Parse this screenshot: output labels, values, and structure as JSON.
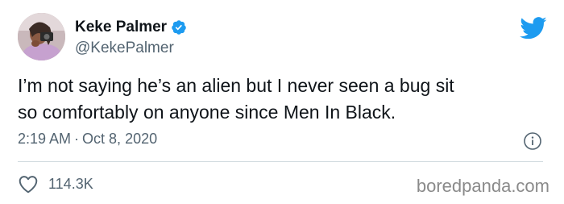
{
  "tweet": {
    "display_name": "Keke Palmer",
    "handle": "@KekePalmer",
    "text": "I’m not saying he’s an alien but I never seen a bug sit\nso comfortably on anyone since Men In Black.",
    "time": "2:19 AM",
    "separator": "·",
    "date": "Oct 8, 2020",
    "like_count": "114.3K"
  },
  "icons": {
    "verified": "verified-badge-icon",
    "logo": "twitter-bird-icon",
    "info": "info-icon",
    "like": "heart-outline-icon"
  },
  "colors": {
    "twitter_blue": "#1d9bf0",
    "secondary_text": "#536471",
    "divider": "#cfd9de"
  },
  "watermark": "boredpanda.com"
}
